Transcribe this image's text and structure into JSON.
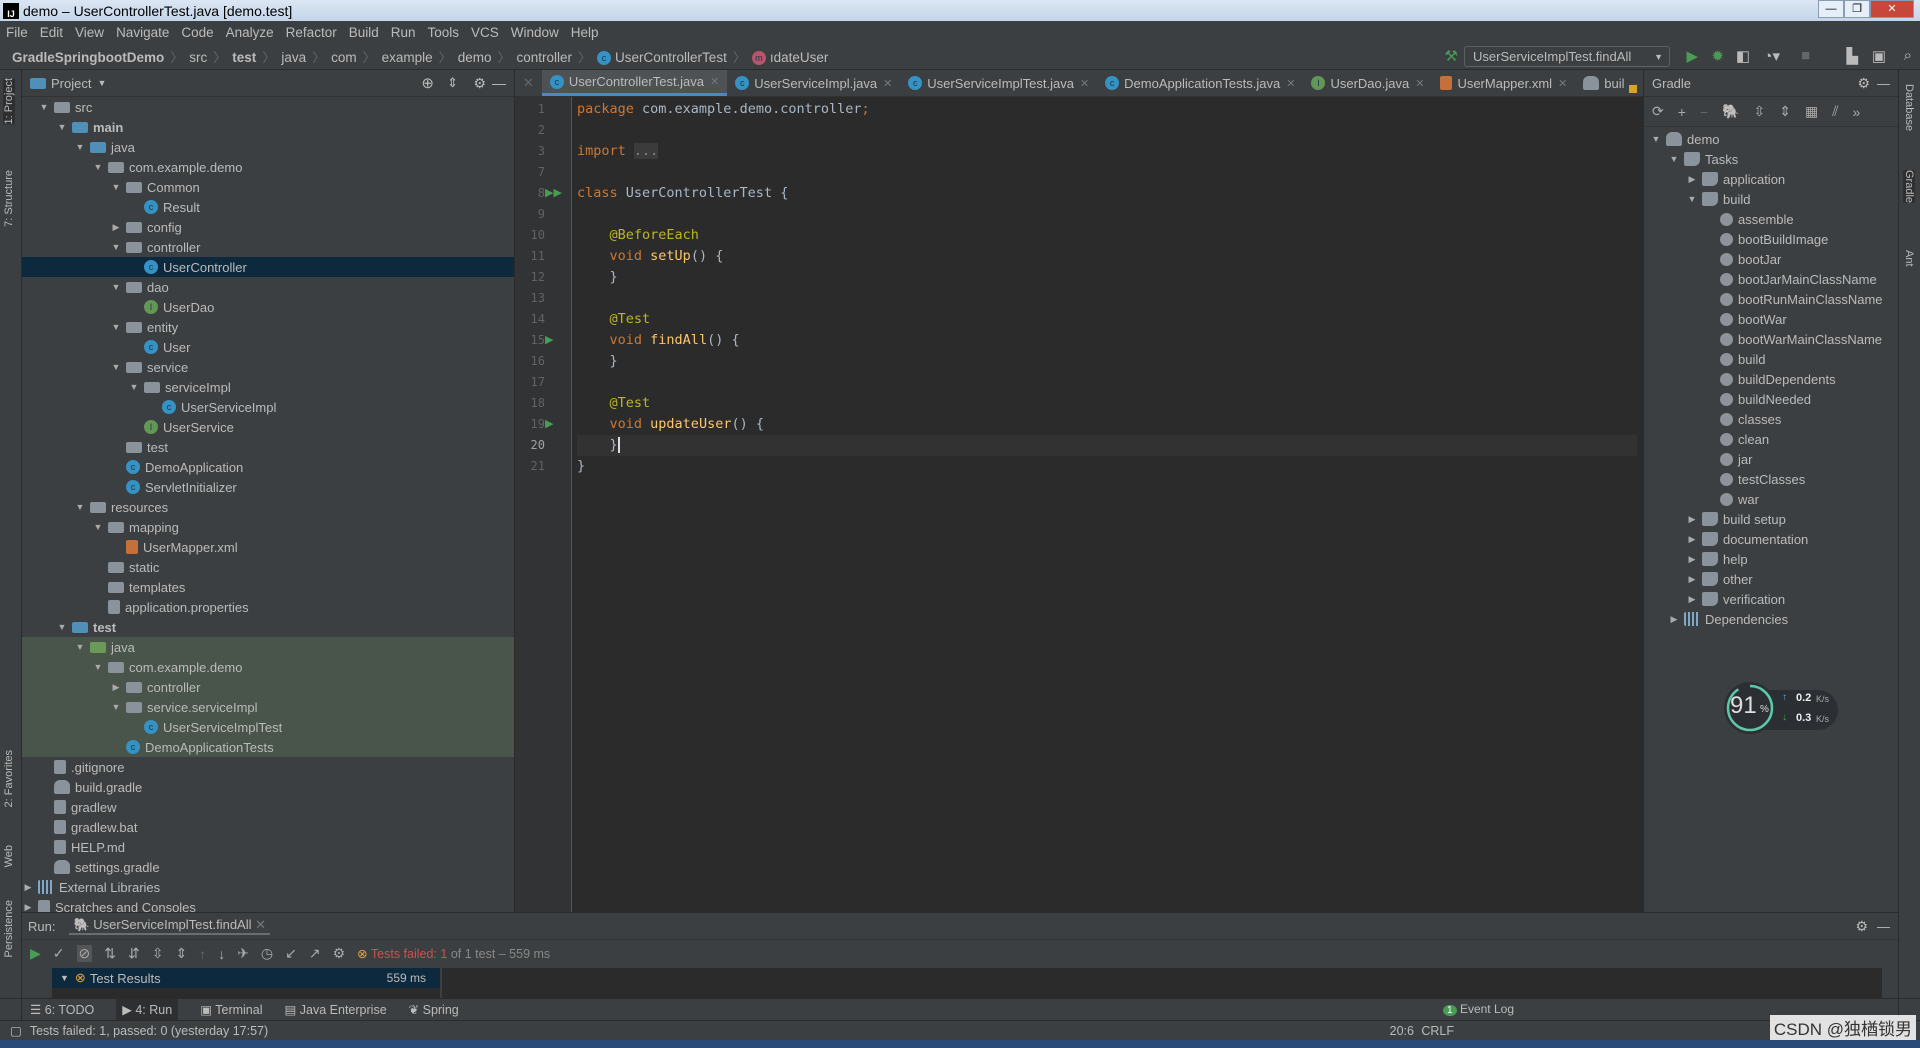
{
  "window": {
    "title": "demo – UserControllerTest.java [demo.test]",
    "logo": "IJ"
  },
  "menu": [
    "File",
    "Edit",
    "View",
    "Navigate",
    "Code",
    "Analyze",
    "Refactor",
    "Build",
    "Run",
    "Tools",
    "VCS",
    "Window",
    "Help"
  ],
  "breadcrumb": [
    {
      "label": "GradleSpringbootDemo",
      "bold": true
    },
    {
      "label": "src"
    },
    {
      "label": "test",
      "bold": true
    },
    {
      "label": "java"
    },
    {
      "label": "com"
    },
    {
      "label": "example"
    },
    {
      "label": "demo"
    },
    {
      "label": "controller"
    },
    {
      "label": "UserControllerTest",
      "icon": "class"
    },
    {
      "label": "ıdateUser",
      "icon": "method"
    }
  ],
  "toolbar": {
    "run_config": "UserServiceImplTest.findAll"
  },
  "project": {
    "title": "Project",
    "tree": [
      {
        "label": "src",
        "depth": 1,
        "arrow": "open",
        "icon": "folder"
      },
      {
        "label": "main",
        "depth": 2,
        "arrow": "open",
        "icon": "src",
        "bold": true
      },
      {
        "label": "java",
        "depth": 3,
        "arrow": "open",
        "icon": "src"
      },
      {
        "label": "com.example.demo",
        "depth": 4,
        "arrow": "open",
        "icon": "folder"
      },
      {
        "label": "Common",
        "depth": 5,
        "arrow": "open",
        "icon": "folder"
      },
      {
        "label": "Result",
        "depth": 6,
        "icon": "class"
      },
      {
        "label": "config",
        "depth": 5,
        "arrow": "closed",
        "icon": "folder"
      },
      {
        "label": "controller",
        "depth": 5,
        "arrow": "open",
        "icon": "folder"
      },
      {
        "label": "UserController",
        "depth": 6,
        "icon": "class",
        "selected": true
      },
      {
        "label": "dao",
        "depth": 5,
        "arrow": "open",
        "icon": "folder"
      },
      {
        "label": "UserDao",
        "depth": 6,
        "icon": "iface"
      },
      {
        "label": "entity",
        "depth": 5,
        "arrow": "open",
        "icon": "folder"
      },
      {
        "label": "User",
        "depth": 6,
        "icon": "class"
      },
      {
        "label": "service",
        "depth": 5,
        "arrow": "open",
        "icon": "folder"
      },
      {
        "label": "serviceImpl",
        "depth": 6,
        "arrow": "open",
        "icon": "folder"
      },
      {
        "label": "UserServiceImpl",
        "depth": 7,
        "icon": "class"
      },
      {
        "label": "UserService",
        "depth": 6,
        "icon": "iface"
      },
      {
        "label": "test",
        "depth": 5,
        "icon": "folder"
      },
      {
        "label": "DemoApplication",
        "depth": 5,
        "icon": "class"
      },
      {
        "label": "ServletInitializer",
        "depth": 5,
        "icon": "class"
      },
      {
        "label": "resources",
        "depth": 3,
        "arrow": "open",
        "icon": "folder"
      },
      {
        "label": "mapping",
        "depth": 4,
        "arrow": "open",
        "icon": "folder"
      },
      {
        "label": "UserMapper.xml",
        "depth": 5,
        "icon": "xml"
      },
      {
        "label": "static",
        "depth": 4,
        "icon": "folder"
      },
      {
        "label": "templates",
        "depth": 4,
        "icon": "folder"
      },
      {
        "label": "application.properties",
        "depth": 4,
        "icon": "file"
      },
      {
        "label": "test",
        "depth": 2,
        "arrow": "open",
        "icon": "src",
        "bold": true
      },
      {
        "label": "java",
        "depth": 3,
        "arrow": "open",
        "icon": "jfolder",
        "test": true
      },
      {
        "label": "com.example.demo",
        "depth": 4,
        "arrow": "open",
        "icon": "folder",
        "test": true
      },
      {
        "label": "controller",
        "depth": 5,
        "arrow": "closed",
        "icon": "folder",
        "test": true
      },
      {
        "label": "service.serviceImpl",
        "depth": 5,
        "arrow": "open",
        "icon": "folder",
        "test": true
      },
      {
        "label": "UserServiceImplTest",
        "depth": 6,
        "icon": "class",
        "test": true
      },
      {
        "label": "DemoApplicationTests",
        "depth": 5,
        "icon": "class",
        "test": true
      },
      {
        "label": ".gitignore",
        "depth": 1,
        "icon": "file"
      },
      {
        "label": "build.gradle",
        "depth": 1,
        "icon": "gradle"
      },
      {
        "label": "gradlew",
        "depth": 1,
        "icon": "file"
      },
      {
        "label": "gradlew.bat",
        "depth": 1,
        "icon": "file"
      },
      {
        "label": "HELP.md",
        "depth": 1,
        "icon": "file"
      },
      {
        "label": "settings.gradle",
        "depth": 1,
        "icon": "gradle"
      },
      {
        "label": "External Libraries",
        "depth": 0,
        "arrow": "closed",
        "icon": "lib"
      },
      {
        "label": "Scratches and Consoles",
        "depth": 0,
        "arrow": "closed",
        "icon": "file"
      }
    ]
  },
  "tabs": [
    {
      "label": "UserControllerTest.java",
      "icon": "class",
      "active": true
    },
    {
      "label": "UserServiceImpl.java",
      "icon": "class"
    },
    {
      "label": "UserServiceImplTest.java",
      "icon": "class"
    },
    {
      "label": "DemoApplicationTests.java",
      "icon": "class"
    },
    {
      "label": "UserDao.java",
      "icon": "iface"
    },
    {
      "label": "UserMapper.xml",
      "icon": "xml"
    },
    {
      "label": "buil",
      "icon": "gradle"
    }
  ],
  "editor": {
    "lines": [
      {
        "n": "1",
        "html": "<span class='kw'>package</span> com.example.demo.controller<span class='kw'>;</span>"
      },
      {
        "n": "2",
        "html": ""
      },
      {
        "n": "3",
        "html": "<span class='kw'>import</span> <span class='fold'>...</span>"
      },
      {
        "n": "7",
        "html": ""
      },
      {
        "n": "8",
        "html": "<span class='kw'>class</span> UserControllerTest {",
        "run": "double"
      },
      {
        "n": "9",
        "html": ""
      },
      {
        "n": "10",
        "html": "    <span class='ann'>@BeforeEach</span>"
      },
      {
        "n": "11",
        "html": "    <span class='kw'>void</span> <span class='fn'>setUp</span>() {"
      },
      {
        "n": "12",
        "html": "    }"
      },
      {
        "n": "13",
        "html": ""
      },
      {
        "n": "14",
        "html": "    <span class='ann'>@Test</span>"
      },
      {
        "n": "15",
        "html": "    <span class='kw'>void</span> <span class='fn'>findAll</span>() {",
        "run": "single"
      },
      {
        "n": "16",
        "html": "    }"
      },
      {
        "n": "17",
        "html": ""
      },
      {
        "n": "18",
        "html": "    <span class='ann'>@Test</span>"
      },
      {
        "n": "19",
        "html": "    <span class='kw'>void</span> <span class='fn'>updateUser</span>() {",
        "run": "single"
      },
      {
        "n": "20",
        "html": "    }",
        "current": true
      },
      {
        "n": "21",
        "html": "}"
      }
    ]
  },
  "gradle": {
    "title": "Gradle",
    "tree": [
      {
        "label": "demo",
        "depth": 0,
        "arrow": "open",
        "icon": "gradle"
      },
      {
        "label": "Tasks",
        "depth": 1,
        "arrow": "open",
        "icon": "bld"
      },
      {
        "label": "application",
        "depth": 2,
        "arrow": "closed",
        "icon": "bld"
      },
      {
        "label": "build",
        "depth": 2,
        "arrow": "open",
        "icon": "bld"
      },
      {
        "label": "assemble",
        "depth": 3,
        "icon": "gear"
      },
      {
        "label": "bootBuildImage",
        "depth": 3,
        "icon": "gear"
      },
      {
        "label": "bootJar",
        "depth": 3,
        "icon": "gear"
      },
      {
        "label": "bootJarMainClassName",
        "depth": 3,
        "icon": "gear"
      },
      {
        "label": "bootRunMainClassName",
        "depth": 3,
        "icon": "gear"
      },
      {
        "label": "bootWar",
        "depth": 3,
        "icon": "gear"
      },
      {
        "label": "bootWarMainClassName",
        "depth": 3,
        "icon": "gear"
      },
      {
        "label": "build",
        "depth": 3,
        "icon": "gear"
      },
      {
        "label": "buildDependents",
        "depth": 3,
        "icon": "gear"
      },
      {
        "label": "buildNeeded",
        "depth": 3,
        "icon": "gear"
      },
      {
        "label": "classes",
        "depth": 3,
        "icon": "gear"
      },
      {
        "label": "clean",
        "depth": 3,
        "icon": "gear"
      },
      {
        "label": "jar",
        "depth": 3,
        "icon": "gear"
      },
      {
        "label": "testClasses",
        "depth": 3,
        "icon": "gear"
      },
      {
        "label": "war",
        "depth": 3,
        "icon": "gear"
      },
      {
        "label": "build setup",
        "depth": 2,
        "arrow": "closed",
        "icon": "bld"
      },
      {
        "label": "documentation",
        "depth": 2,
        "arrow": "closed",
        "icon": "bld"
      },
      {
        "label": "help",
        "depth": 2,
        "arrow": "closed",
        "icon": "bld"
      },
      {
        "label": "other",
        "depth": 2,
        "arrow": "closed",
        "icon": "bld"
      },
      {
        "label": "verification",
        "depth": 2,
        "arrow": "closed",
        "icon": "bld"
      },
      {
        "label": "Dependencies",
        "depth": 1,
        "arrow": "closed",
        "icon": "lib"
      }
    ]
  },
  "netmon": {
    "cpu": "91",
    "unit": "%",
    "up": "0.2",
    "down": "0.3",
    "rate_unit": "K/s",
    "level_percent": 91
  },
  "sidestrips": {
    "left": [
      "1: Project",
      "7: Structure",
      "2: Favorites",
      "Web",
      "Persistence"
    ],
    "right": [
      "Database",
      "Gradle",
      "Ant"
    ]
  },
  "run": {
    "label": "Run:",
    "tab": "UserServiceImplTest.findAll",
    "status_prefix": "Tests failed: ",
    "failed": "1",
    "status_suffix": " of 1 test – 559 ms",
    "results_label": "Test Results",
    "results_time": "559 ms"
  },
  "bottom_tabs": [
    {
      "label": "6: TODO",
      "icon": "☰"
    },
    {
      "label": "4: Run",
      "icon": "▶",
      "active": true
    },
    {
      "label": "Terminal",
      "icon": "▣"
    },
    {
      "label": "Java Enterprise",
      "icon": "▤"
    },
    {
      "label": "Spring",
      "icon": "❦"
    }
  ],
  "status": {
    "message": "Tests failed: 1, passed: 0 (yesterday 17:57)",
    "position": "20:6",
    "line_sep": "CRLF",
    "event_log": "Event Log",
    "event_count": "1",
    "watermark": "CSDN @独楢锁男"
  },
  "colors": {
    "accent": "#4a88c7",
    "fail": "#c75450",
    "run_green": "#499c54"
  }
}
